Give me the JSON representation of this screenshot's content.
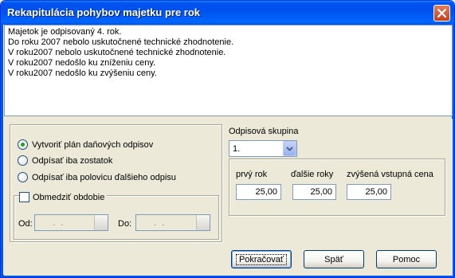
{
  "window": {
    "title": "Rekapitulácia pohybov majetku pre rok"
  },
  "memo": {
    "lines": [
      "Majetok je odpisovaný 4. rok.",
      "Do roku 2007 nebolo uskutočnené technické zhodnotenie.",
      "V roku2007 nebolo uskutočnené technické zhodnotenie.",
      "V roku2007 nedošlo ku zníženiu ceny.",
      "V roku2007 nedošlo ku zvýšeniu ceny."
    ]
  },
  "options": {
    "radios": [
      {
        "label": "Vytvoriť plán daňových odpisov",
        "checked": true
      },
      {
        "label": "Odpísať iba zostatok",
        "checked": false
      },
      {
        "label": "Odpísať iba polovicu ďalšieho odpisu",
        "checked": false
      }
    ],
    "limit_period_label": "Obmedziť obdobie",
    "limit_period_checked": false,
    "from_label": "Od:",
    "from_value": ". .",
    "to_label": "Do:",
    "to_value": ". ."
  },
  "depreciation": {
    "group_label": "Odpisová skupina",
    "group_value": "1.",
    "first_year_label": "prvý rok",
    "first_year_value": "25,00",
    "next_years_label": "ďalšie roky",
    "next_years_value": "25,00",
    "increased_label": "zvýšená vstupná cena",
    "increased_value": "25,00"
  },
  "buttons": {
    "continue": "Pokračovať",
    "back": "Späť",
    "help": "Pomoc"
  },
  "colors": {
    "titlebar": "#0054e3",
    "face": "#ece9d8",
    "radio_check": "#21a121"
  }
}
